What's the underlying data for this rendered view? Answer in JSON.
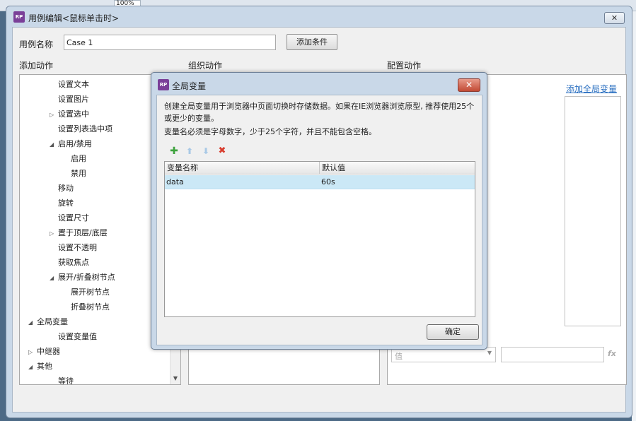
{
  "background": {
    "zoom": "100%"
  },
  "case_editor": {
    "title": "用例编辑<鼠标单击时>",
    "close_label": "✕",
    "case_name_label": "用例名称",
    "case_name_value": "Case 1",
    "add_condition_label": "添加条件",
    "col_add_actions": "添加动作",
    "col_organize_actions": "组织动作",
    "col_configure_actions": "配置动作",
    "add_global_link": "添加全局变量",
    "value_select": "值",
    "fx_label": "fx",
    "tree": [
      {
        "label": "设置文本",
        "level": 1,
        "arrow": ""
      },
      {
        "label": "设置图片",
        "level": 1,
        "arrow": ""
      },
      {
        "label": "设置选中",
        "level": 1,
        "arrow": "▷"
      },
      {
        "label": "设置列表选中项",
        "level": 1,
        "arrow": ""
      },
      {
        "label": "启用/禁用",
        "level": 1,
        "arrow": "◢"
      },
      {
        "label": "启用",
        "level": 2,
        "arrow": ""
      },
      {
        "label": "禁用",
        "level": 2,
        "arrow": ""
      },
      {
        "label": "移动",
        "level": 1,
        "arrow": ""
      },
      {
        "label": "旋转",
        "level": 1,
        "arrow": ""
      },
      {
        "label": "设置尺寸",
        "level": 1,
        "arrow": ""
      },
      {
        "label": "置于顶层/底层",
        "level": 1,
        "arrow": "▷"
      },
      {
        "label": "设置不透明",
        "level": 1,
        "arrow": ""
      },
      {
        "label": "获取焦点",
        "level": 1,
        "arrow": ""
      },
      {
        "label": "展开/折叠树节点",
        "level": 1,
        "arrow": "◢"
      },
      {
        "label": "展开树节点",
        "level": 2,
        "arrow": ""
      },
      {
        "label": "折叠树节点",
        "level": 2,
        "arrow": ""
      },
      {
        "label": "全局变量",
        "level": 0,
        "arrow": "◢"
      },
      {
        "label": "设置变量值",
        "level": 1,
        "arrow": ""
      },
      {
        "label": "中继器",
        "level": 0,
        "arrow": "▷"
      },
      {
        "label": "其他",
        "level": 0,
        "arrow": "◢"
      },
      {
        "label": "等待",
        "level": 1,
        "arrow": ""
      }
    ]
  },
  "global_vars": {
    "title": "全局变量",
    "close_label": "✕",
    "description": "创建全局变量用于浏览器中页面切换时存储数据。如果在IE浏览器浏览原型, 推荐使用25个或更少的变量。",
    "rule": "变量名必须是字母数字，少于25个字符，并且不能包含空格。",
    "columns": [
      "变量名称",
      "默认值"
    ],
    "rows": [
      {
        "name": "data",
        "default": "60s"
      }
    ],
    "ok_label": "确定"
  }
}
